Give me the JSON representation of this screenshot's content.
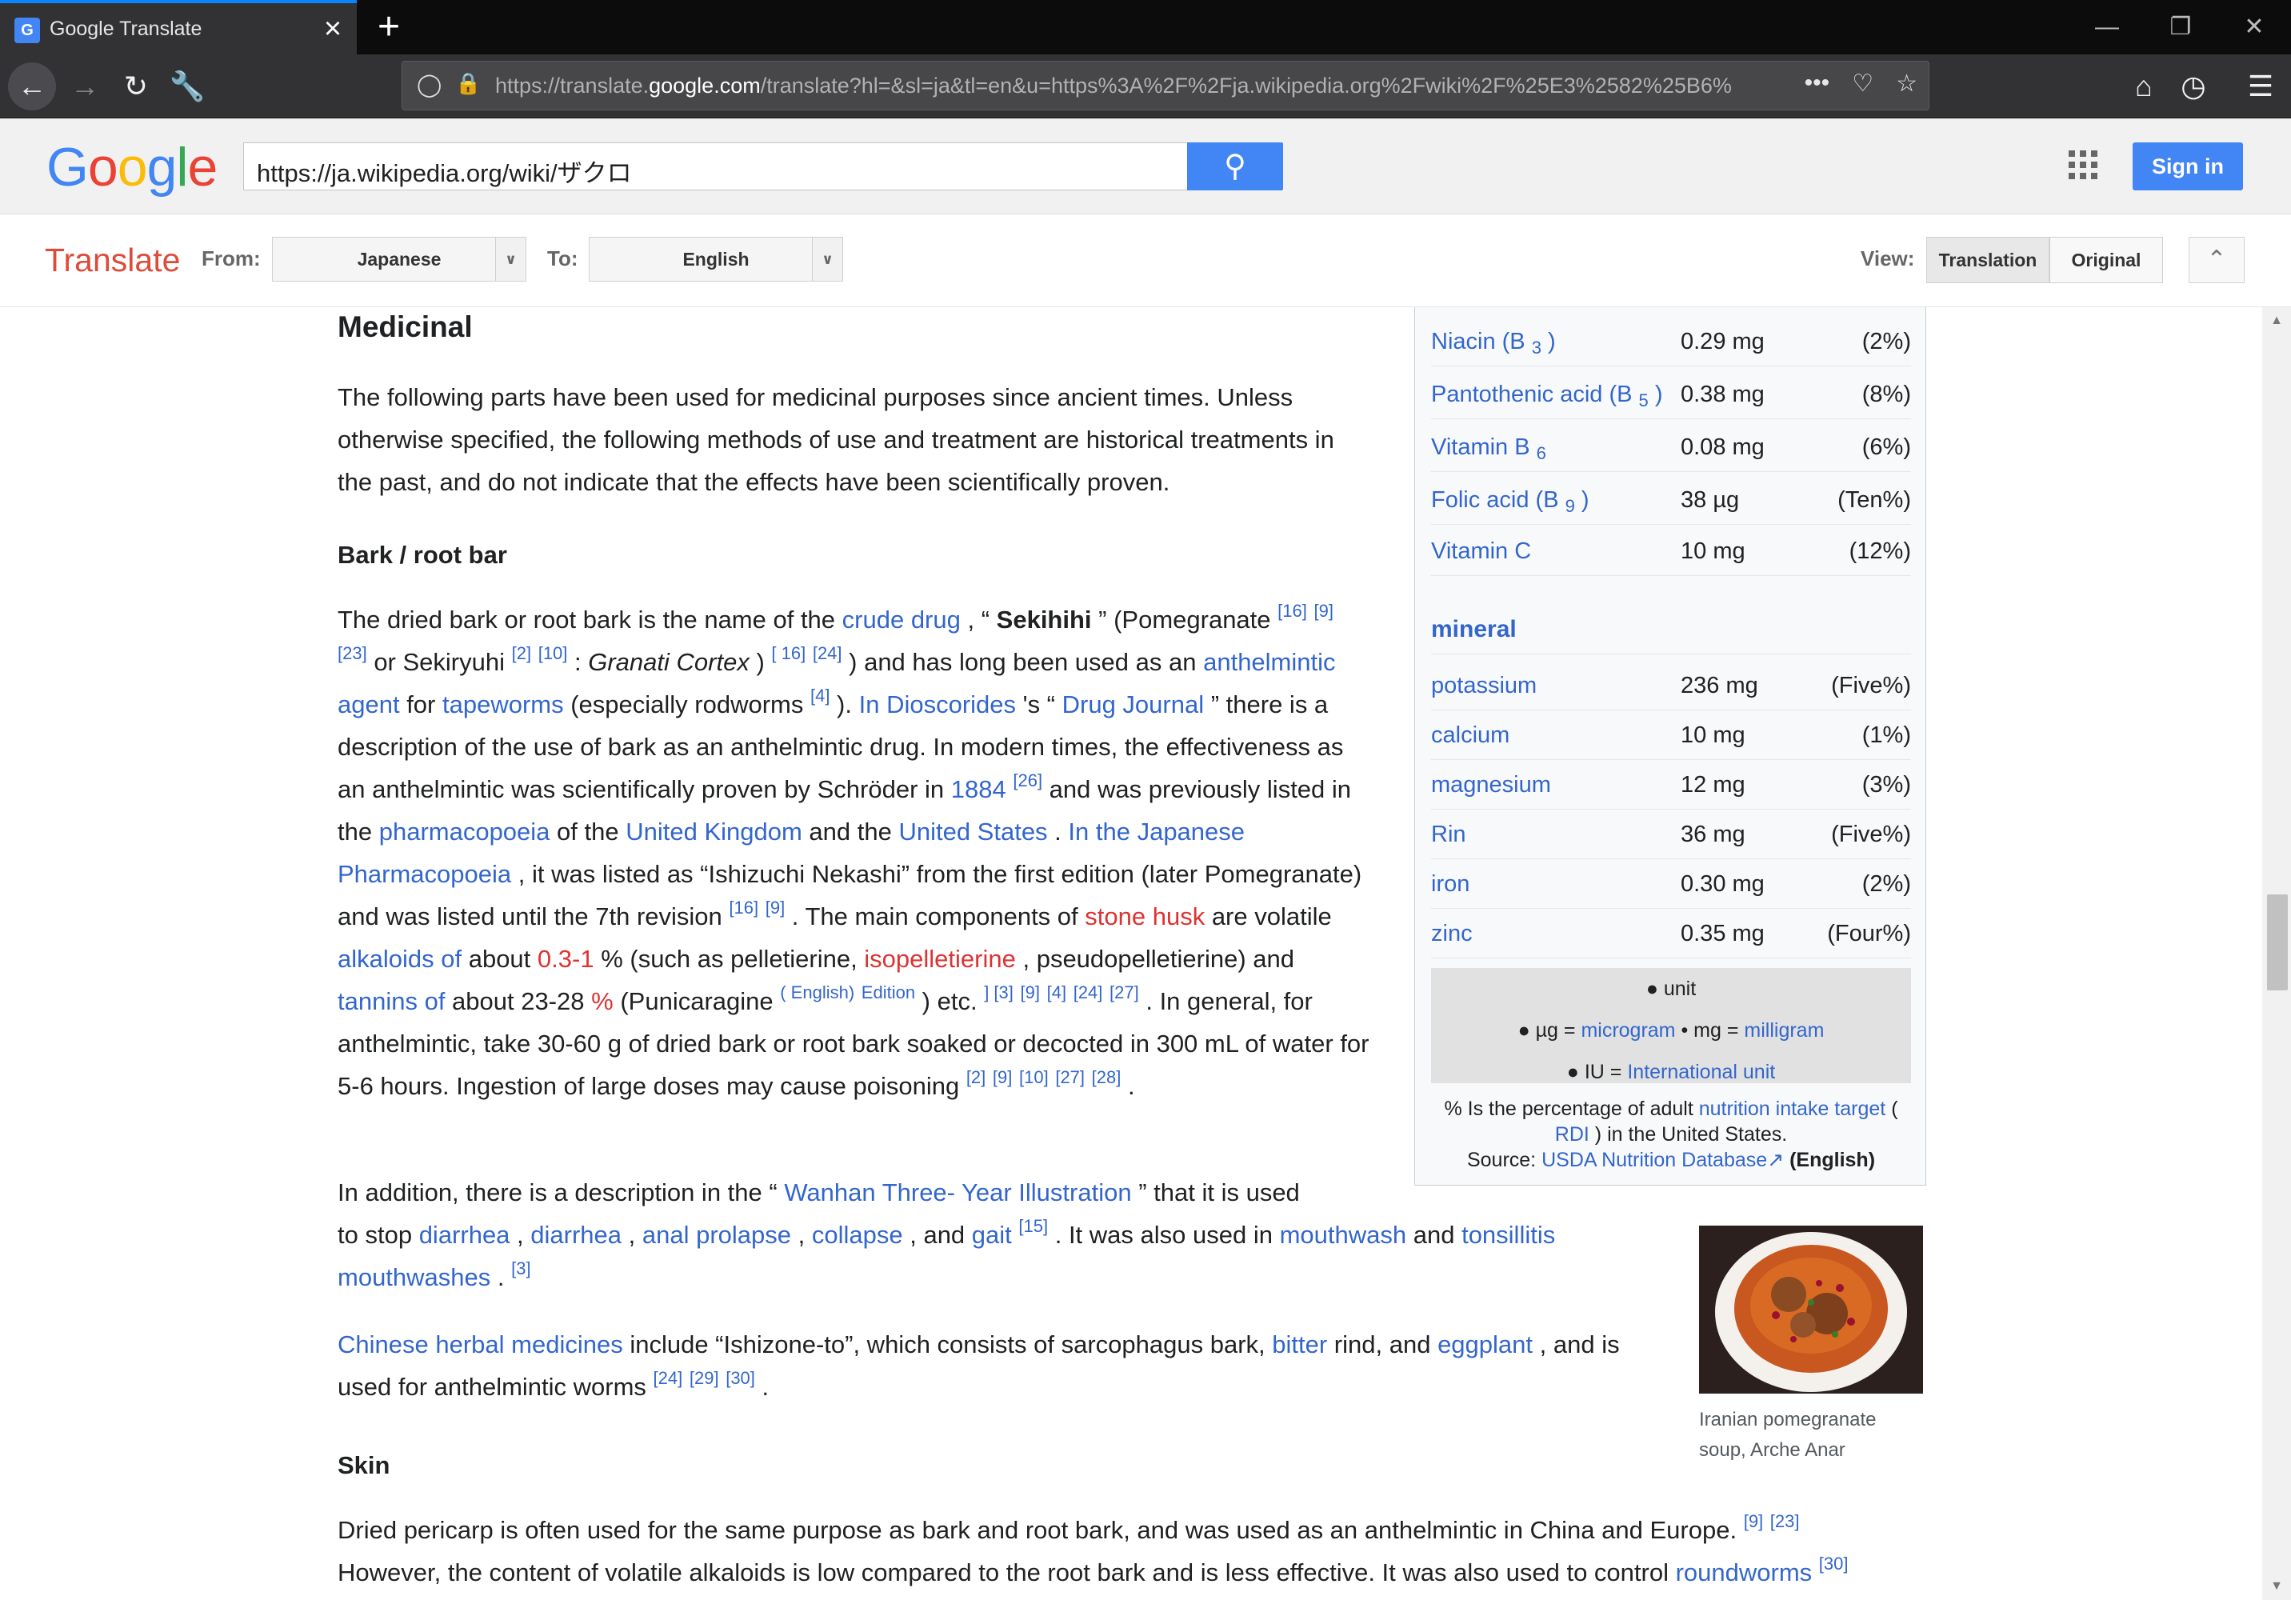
{
  "browser": {
    "tab_title": "Google Translate",
    "tab_close": "×",
    "new_tab": "+",
    "url_prefix": "https://translate.",
    "url_domain": "google.com",
    "url_rest": "/translate?hl=&sl=ja&tl=en&u=https%3A%2F%2Fja.wikipedia.org%2Fwiki%2F%25E3%2582%25B6%",
    "page_actions": "•••"
  },
  "google": {
    "logo": [
      "G",
      "o",
      "o",
      "g",
      "l",
      "e"
    ],
    "search_value": "https://ja.wikipedia.org/wiki/ザクロ",
    "signin": "Sign in"
  },
  "translate_bar": {
    "title": "Translate",
    "from_label": "From:",
    "from_value": "Japanese",
    "to_label": "To:",
    "to_value": "English",
    "view_label": "View:",
    "view_translation": "Translation",
    "view_original": "Original"
  },
  "article": {
    "h_medicinal": "Medicinal",
    "p_intro": "The following parts have been used for medicinal purposes since ancient times. Unless otherwise specified, the following methods of use and treatment are historical treatments in the past, and do not indicate that the effects have been scientifically proven.",
    "h_bark": "Bark / root bar",
    "h_skin": "Skin",
    "p_skin_1": "Dried pericarp is often used for the same purpose as bark and root bark, and was used as an anthelmintic in China and Europe.",
    "p_skin_2": "However, the content of volatile alkaloids is low compared to the root bark and is less effective. It was also used to control",
    "p_skin_link": "roundworms",
    "image_caption": "Iranian pomegranate soup, Arche Anar"
  },
  "infobox": {
    "vitamins": [
      {
        "name": "Niacin (B",
        "sub": "3",
        "close": ")",
        "value": "0.29 mg",
        "pct": "(2%)"
      },
      {
        "name": "Pantothenic acid (B",
        "sub": "5",
        "close": ")",
        "value": "0.38 mg",
        "pct": "(8%)"
      },
      {
        "name": "Vitamin B",
        "sub": "6",
        "close": "",
        "value": "0.08 mg",
        "pct": "(6%)"
      },
      {
        "name": "Folic acid (B",
        "sub": "9",
        "close": ")",
        "value": "38 µg",
        "pct": "(Ten%)"
      },
      {
        "name": "Vitamin C",
        "sub": "",
        "close": "",
        "value": "10 mg",
        "pct": "(12%)"
      }
    ],
    "mineral_header": "mineral",
    "minerals": [
      {
        "name": "potassium",
        "value": "236 mg",
        "pct": "(Five%)"
      },
      {
        "name": "calcium",
        "value": "10 mg",
        "pct": "(1%)"
      },
      {
        "name": "magnesium",
        "value": "12 mg",
        "pct": "(3%)"
      },
      {
        "name": "Rin",
        "value": "36 mg",
        "pct": "(Five%)"
      },
      {
        "name": "iron",
        "value": "0.30 mg",
        "pct": "(2%)"
      },
      {
        "name": "zinc",
        "value": "0.35 mg",
        "pct": "(Four%)"
      }
    ],
    "units_title": "unit",
    "unit_ug": "µg =",
    "unit_ug_link": "microgram",
    "unit_mg": "• mg =",
    "unit_mg_link": "milligram",
    "unit_iu": "IU =",
    "unit_iu_link": "International unit",
    "foot_1": "% Is the percentage of adult",
    "foot_link1": "nutrition intake target",
    "foot_2": "(",
    "foot_rdi": "RDI",
    "foot_3": ") in the United States.",
    "foot_source": "Source:",
    "foot_source_link": "USDA Nutrition Database",
    "foot_english": "(English)"
  }
}
